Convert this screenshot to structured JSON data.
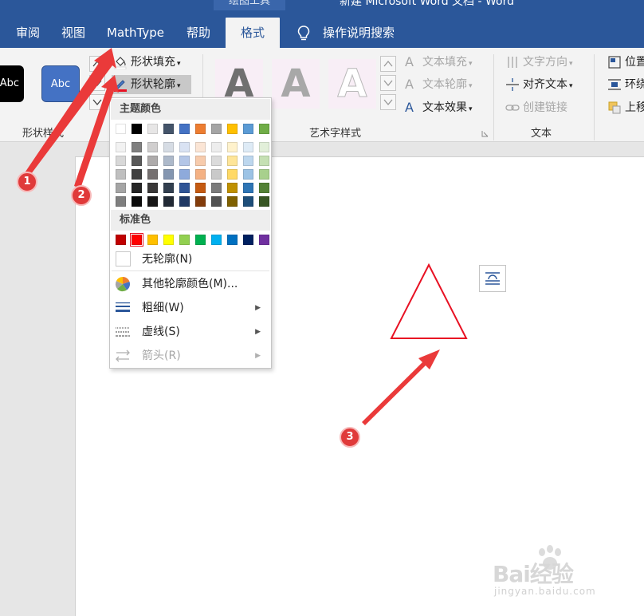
{
  "window": {
    "context_tab": "绘图工具",
    "title": "新建 Microsoft Word 文档  -  Word"
  },
  "tabs": [
    {
      "label": "审阅"
    },
    {
      "label": "视图"
    },
    {
      "label": "MathType"
    },
    {
      "label": "帮助"
    },
    {
      "label": "格式",
      "active": true
    }
  ],
  "search": {
    "label": "操作说明搜索",
    "icon": "lightbulb-icon"
  },
  "ribbon": {
    "shape_styles": {
      "title": "形状样式",
      "preview_black": "Abc",
      "preview_blue": "Abc",
      "fill_label": "形状填充",
      "outline_label": "形状轮廓"
    },
    "wordart": {
      "title": "艺术字样式",
      "glyph": "A",
      "text_fill": "文本填充",
      "text_outline": "文本轮廓",
      "text_effect": "文本效果"
    },
    "text": {
      "title": "文本",
      "direction": "文字方向",
      "align": "对齐文本",
      "link": "创建链接"
    },
    "arrange": {
      "position": "位置",
      "wrap": "环绕",
      "forward": "上移"
    }
  },
  "dropdown": {
    "theme_header": "主题颜色",
    "standard_header": "标准色",
    "theme_colors": [
      [
        "#ffffff",
        "#000000",
        "#e7e6e6",
        "#44546a",
        "#4472c4",
        "#ed7d31",
        "#a5a5a5",
        "#ffc000",
        "#5b9bd5",
        "#70ad47"
      ],
      [
        "#f2f2f2",
        "#7f7f7f",
        "#d0cece",
        "#d6dce4",
        "#d9e2f3",
        "#fbe5d5",
        "#ededed",
        "#fff2cc",
        "#deebf6",
        "#e2efd9"
      ],
      [
        "#d8d8d8",
        "#595959",
        "#aeabab",
        "#adb9ca",
        "#b4c6e7",
        "#f7cbac",
        "#dbdbdb",
        "#fee599",
        "#bdd7ee",
        "#c5e0b3"
      ],
      [
        "#bfbfbf",
        "#3f3f3f",
        "#757070",
        "#8496b0",
        "#8eaadb",
        "#f4b183",
        "#c9c9c9",
        "#ffd965",
        "#9cc3e5",
        "#a8d08d"
      ],
      [
        "#a5a5a5",
        "#262626",
        "#3a3838",
        "#323f4f",
        "#2f5496",
        "#c55a11",
        "#7b7b7b",
        "#bf9000",
        "#2e75b5",
        "#538135"
      ],
      [
        "#7f7f7f",
        "#0c0c0c",
        "#171616",
        "#222a35",
        "#1f3864",
        "#833c0b",
        "#525252",
        "#7f6000",
        "#1e4e79",
        "#375623"
      ]
    ],
    "standard_colors": [
      "#c00000",
      "#ff0000",
      "#ffc000",
      "#ffff00",
      "#92d050",
      "#00b050",
      "#00b0f0",
      "#0070c0",
      "#002060",
      "#7030a0"
    ],
    "selected_standard_index": 1,
    "no_outline": "无轮廓(N)",
    "more_colors": "其他轮廓颜色(M)...",
    "weight": "粗细(W)",
    "dashes": "虚线(S)",
    "arrows": "箭头(R)"
  },
  "document": {
    "shape": "triangle",
    "outline_color": "#e81123"
  },
  "annotations": [
    {
      "label": "1"
    },
    {
      "label": "2"
    },
    {
      "label": "3"
    }
  ],
  "watermark": {
    "brand": "Bai经验",
    "url": "jingyan.baidu.com"
  }
}
